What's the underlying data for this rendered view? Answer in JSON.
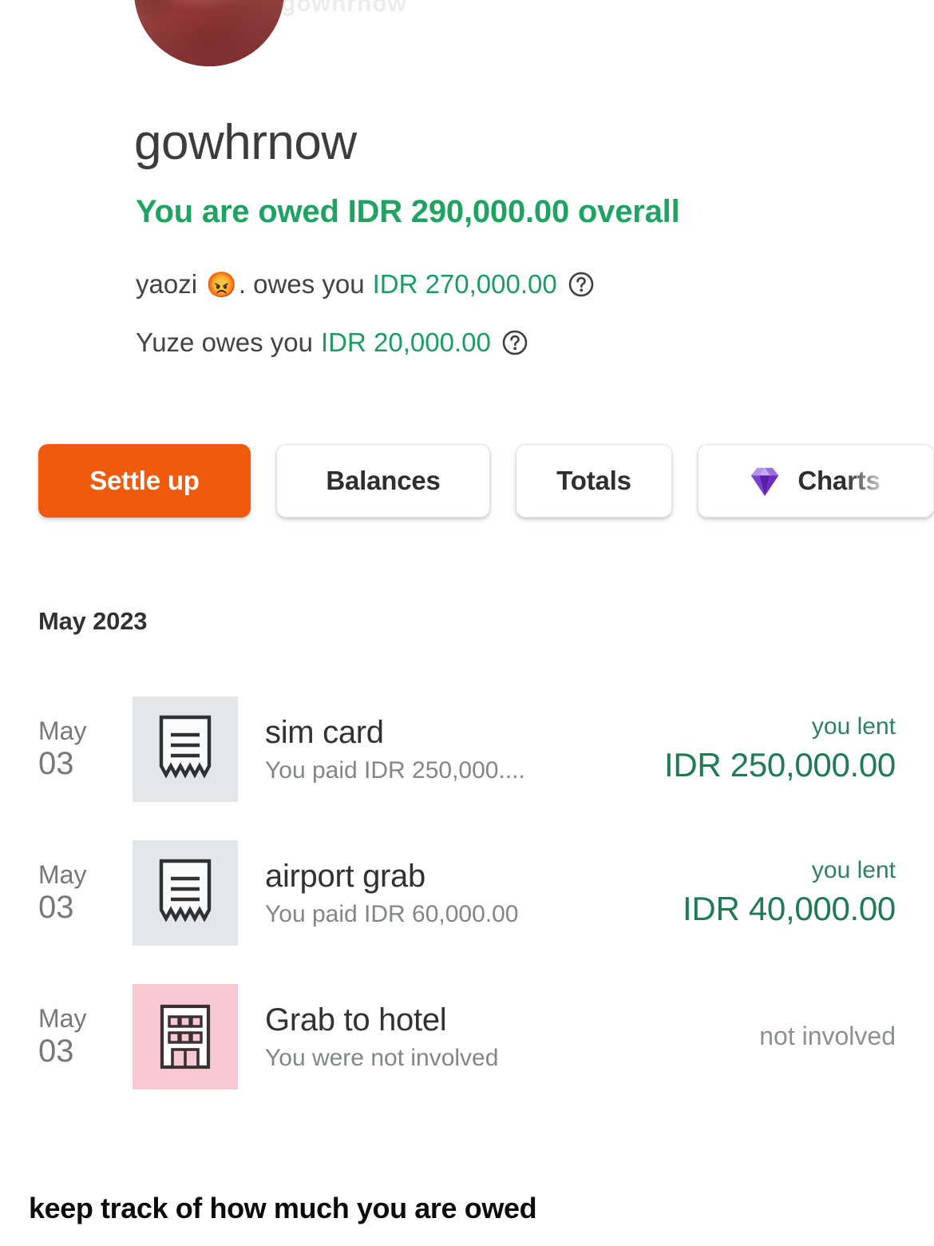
{
  "header": {
    "avatar_name": "group-avatar",
    "ghost_text": "gowhrnow",
    "group_title": "gowhrnow",
    "overall_balance": "You are owed IDR 290,000.00 overall",
    "debts": [
      {
        "who": "yaozi ",
        "emoji": "😡",
        "who_tail": ". owes you",
        "amount": "IDR 270,000.00",
        "help_icon": "question-circle-icon"
      },
      {
        "who": "Yuze owes you",
        "emoji": "",
        "who_tail": "",
        "amount": "IDR 20,000.00",
        "help_icon": "question-circle-icon"
      }
    ]
  },
  "actions": {
    "settle_up": "Settle up",
    "balances": "Balances",
    "totals": "Totals",
    "charts": "Charts",
    "charts_icon": "gem-icon"
  },
  "list": {
    "month_label": "May 2023",
    "rows": [
      {
        "month": "May",
        "day": "03",
        "icon": "receipt-icon",
        "icon_kind": "receipt",
        "title": "sim card",
        "subtitle": "You paid IDR 250,000....",
        "right_label": "you lent",
        "right_value": "IDR 250,000.00",
        "state": "lent"
      },
      {
        "month": "May",
        "day": "03",
        "icon": "receipt-icon",
        "icon_kind": "receipt",
        "title": "airport grab",
        "subtitle": "You paid IDR 60,000.00",
        "right_label": "you lent",
        "right_value": "IDR 40,000.00",
        "state": "lent"
      },
      {
        "month": "May",
        "day": "03",
        "icon": "hotel-icon",
        "icon_kind": "hotel",
        "title": "Grab to hotel",
        "subtitle": "You were not involved",
        "right_label": "not involved",
        "right_value": "",
        "state": "neutral"
      }
    ]
  },
  "footer": {
    "caption": "keep track of how much you are owed"
  },
  "colors": {
    "accent_orange": "#ef5a0c",
    "balance_green": "#1ea363",
    "amount_green": "#1f7a55",
    "muted_gray": "#818689",
    "receipt_tile": "#e4e7e9",
    "hotel_tile": "#f8c8d3",
    "gem_purple": "#6d28b8"
  }
}
